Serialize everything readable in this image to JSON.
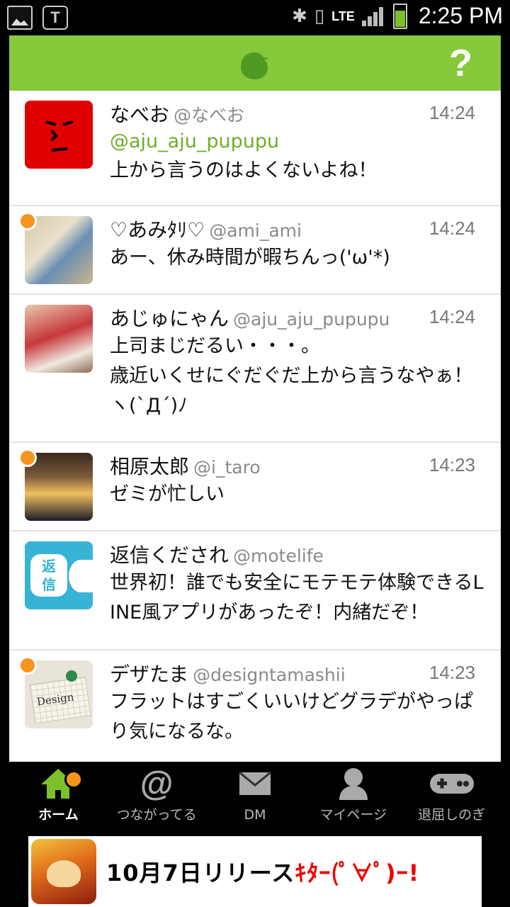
{
  "status_bar": {
    "network": "LTE",
    "time": "2:25 PM"
  },
  "header": {
    "help_label": "?"
  },
  "tweets": [
    {
      "name": "なべお",
      "handle": "@なべお",
      "time": "14:24",
      "reply_to": "@aju_aju_pupupu",
      "body": "上から言うのはよくないよね！",
      "unread": false
    },
    {
      "name": "♡あみﾀﾘ♡",
      "handle": "@ami_ami",
      "time": "14:24",
      "body": "あー、休み時間が暇ちんっ('ω'*)",
      "unread": true
    },
    {
      "name": "あじゅにゃん",
      "handle": "@aju_aju_pupupu",
      "time": "14:24",
      "body": "上司まじだるい・・・。\n歳近いくせにぐだぐだ上から言うなやぁ！\nヽ(`Д´)ﾉ",
      "unread": false
    },
    {
      "name": "相原太郎",
      "handle": "@i_taro",
      "time": "14:23",
      "body": "ゼミが忙しい",
      "unread": true
    },
    {
      "name": "返信くだされ",
      "handle": "@motelife",
      "time": "",
      "body": "世界初！誰でも安全にモテモテ体験できるLINE風アプリがあったぞ！内緒だぞ！",
      "unread": false,
      "avatar_text": [
        "返",
        "信"
      ]
    },
    {
      "name": "デザたま",
      "handle": "@designtamashii",
      "time": "14:23",
      "body": "フラットはすごくいいけどグラデがやっぱり気になるな。",
      "unread": true,
      "avatar_text": [
        "Design"
      ]
    }
  ],
  "bottom_nav": [
    {
      "label": "ホーム",
      "icon": "home-icon",
      "active": true
    },
    {
      "label": "つながってる",
      "icon": "at-icon",
      "active": false
    },
    {
      "label": "DM",
      "icon": "mail-icon",
      "active": false
    },
    {
      "label": "マイページ",
      "icon": "person-icon",
      "active": false
    },
    {
      "label": "退屈しのぎ",
      "icon": "gamepad-icon",
      "active": false
    }
  ],
  "ad": {
    "text_black": "10月7日リリース",
    "text_red": "ｷﾀｰ(ﾟ∀ﾟ)ｰ!"
  },
  "colors": {
    "header": "#86c93a",
    "accent_green": "#6fae2a",
    "unread_dot": "#f7941d"
  }
}
